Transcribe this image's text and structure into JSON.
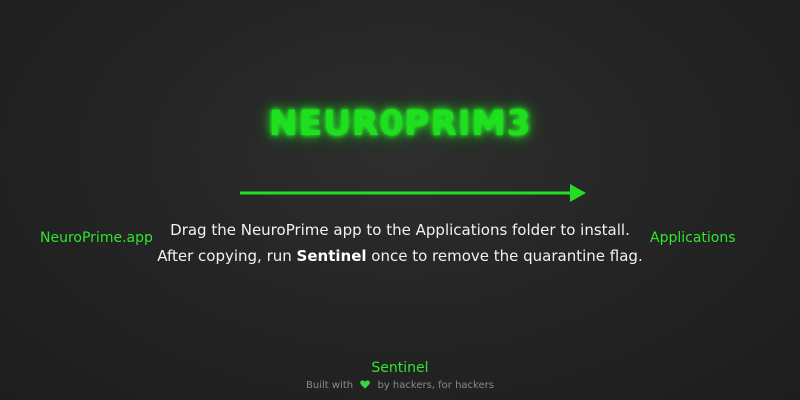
{
  "logo": {
    "text": "NEUR0PRIM3",
    "color": "#1fe01f"
  },
  "source": {
    "label": "NeuroPrime.app"
  },
  "target": {
    "label": "Applications"
  },
  "instructions": {
    "line1": "Drag the NeuroPrime app to the Applications folder to install.",
    "line2_before": "After copying, run ",
    "line2_bold": "Sentinel",
    "line2_after": " once to remove the quarantine flag."
  },
  "sentinel": {
    "label": "Sentinel"
  },
  "footer": {
    "prefix": "Built with",
    "heart_icon": "green-heart-icon",
    "suffix": "by hackers, for hackers"
  },
  "colors": {
    "accent": "#22dd22",
    "background": "#262626",
    "text": "#f2f2f2",
    "muted": "#8a8a8a"
  }
}
